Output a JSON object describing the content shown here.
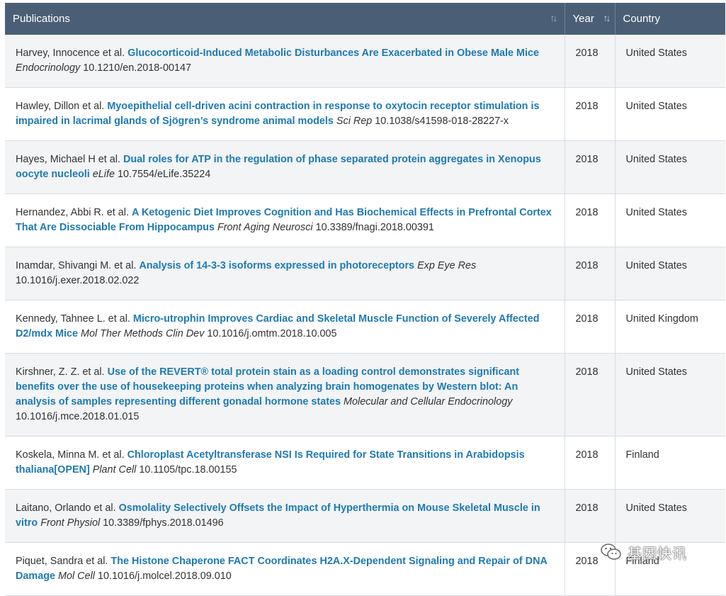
{
  "columns": {
    "publications": "Publications",
    "year": "Year",
    "country": "Country",
    "sort_icon": "↑↓"
  },
  "rows": [
    {
      "authors": "Harvey, Innocence et al.",
      "title": "Glucocorticoid-Induced Metabolic Disturbances Are Exacerbated in Obese Male Mice",
      "journal": "Endocrinology",
      "doi": "10.1210/en.2018-00147",
      "year": "2018",
      "country": "United States"
    },
    {
      "authors": "Hawley, Dillon et al.",
      "title": "Myoepithelial cell-driven acini contraction in response to oxytocin receptor stimulation is impaired in lacrimal glands of Sjögren’s syndrome animal models",
      "journal": "Sci Rep",
      "doi": "10.1038/s41598-018-28227-x",
      "year": "2018",
      "country": "United States"
    },
    {
      "authors": "Hayes, Michael H et al.",
      "title": "Dual roles for ATP in the regulation of phase separated protein aggregates in Xenopus oocyte nucleoli",
      "journal": "eLife",
      "doi": "10.7554/eLife.35224",
      "year": "2018",
      "country": "United States"
    },
    {
      "authors": "Hernandez, Abbi R. et al.",
      "title": "A Ketogenic Diet Improves Cognition and Has Biochemical Effects in Prefrontal Cortex That Are Dissociable From Hippocampus",
      "journal": "Front Aging Neurosci",
      "doi": "10.3389/fnagi.2018.00391",
      "year": "2018",
      "country": "United States"
    },
    {
      "authors": "Inamdar, Shivangi M. et al.",
      "title": "Analysis of 14-3-3 isoforms expressed in photoreceptors",
      "journal": "Exp Eye Res",
      "doi": "10.1016/j.exer.2018.02.022",
      "year": "2018",
      "country": "United States"
    },
    {
      "authors": "Kennedy, Tahnee L. et al.",
      "title": "Micro-utrophin Improves Cardiac and Skeletal Muscle Function of Severely Affected D2/mdx Mice",
      "journal": "Mol Ther Methods Clin Dev",
      "doi": "10.1016/j.omtm.2018.10.005",
      "year": "2018",
      "country": "United Kingdom"
    },
    {
      "authors": "Kirshner, Z. Z. et al.",
      "title": "Use of the REVERT® total protein stain as a loading control demonstrates significant benefits over the use of housekeeping proteins when analyzing brain homogenates by Western blot: An analysis of samples representing different gonadal hormone states",
      "journal": "Molecular and Cellular Endocrinology",
      "doi": "10.1016/j.mce.2018.01.015",
      "year": "2018",
      "country": "United States"
    },
    {
      "authors": "Koskela, Minna M. et al.",
      "title": "Chloroplast Acetyltransferase NSI Is Required for State Transitions in Arabidopsis thaliana[OPEN]",
      "journal": "Plant Cell",
      "doi": "10.1105/tpc.18.00155",
      "year": "2018",
      "country": "Finland"
    },
    {
      "authors": "Laitano, Orlando et al.",
      "title": "Osmolality Selectively Offsets the Impact of Hyperthermia on Mouse Skeletal Muscle in vitro",
      "journal": "Front Physiol",
      "doi": "10.3389/fphys.2018.01496",
      "year": "2018",
      "country": "United States"
    },
    {
      "authors": "Piquet, Sandra et al.",
      "title": "The Histone Chaperone FACT Coordinates H2A.X-Dependent Signaling and Repair of DNA Damage",
      "journal": "Mol Cell",
      "doi": "10.1016/j.molcel.2018.09.010",
      "year": "2018",
      "country": "Finland"
    }
  ],
  "watermark": {
    "text": "基因快讯",
    "icon": "wechat-icon"
  },
  "colors": {
    "header_bg": "#4a5f75",
    "link": "#1f7ab2",
    "row_alt": "#f2f4f6"
  }
}
